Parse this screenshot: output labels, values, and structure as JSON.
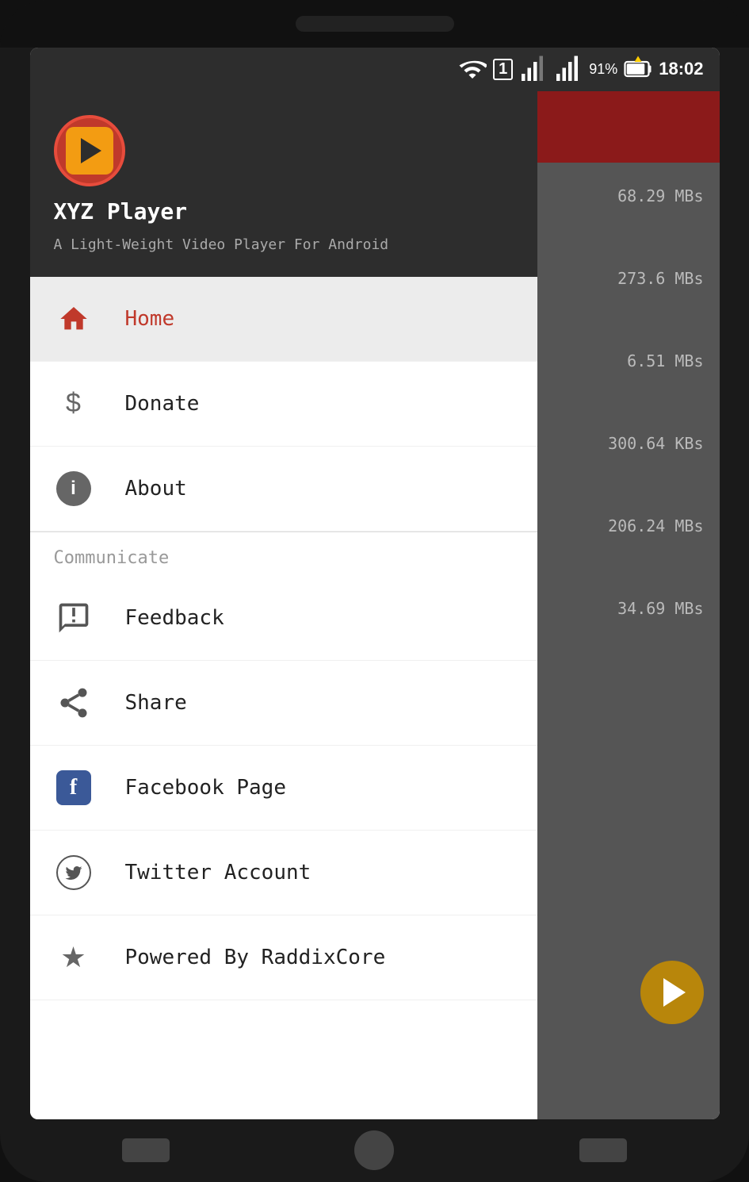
{
  "status_bar": {
    "time": "18:02",
    "battery_pct": "91%"
  },
  "app": {
    "name": "XYZ Player",
    "tagline": "A Light-Weight Video Player For Android"
  },
  "nav": {
    "items": [
      {
        "id": "home",
        "label": "Home",
        "active": true
      },
      {
        "id": "donate",
        "label": "Donate",
        "active": false
      },
      {
        "id": "about",
        "label": "About",
        "active": false
      }
    ],
    "section_communicate": "Communicate",
    "communicate_items": [
      {
        "id": "feedback",
        "label": "Feedback"
      },
      {
        "id": "share",
        "label": "Share"
      },
      {
        "id": "facebook",
        "label": "Facebook Page"
      },
      {
        "id": "twitter",
        "label": "Twitter Account"
      },
      {
        "id": "raddixcore",
        "label": "Powered By RaddixCore"
      }
    ]
  },
  "file_sizes": {
    "s1": "68.29 MBs",
    "s2": "273.6 MBs",
    "s3": "6.51 MBs",
    "s4": "300.64 KBs",
    "s5": "206.24 MBs",
    "s6": "34.69 MBs"
  }
}
